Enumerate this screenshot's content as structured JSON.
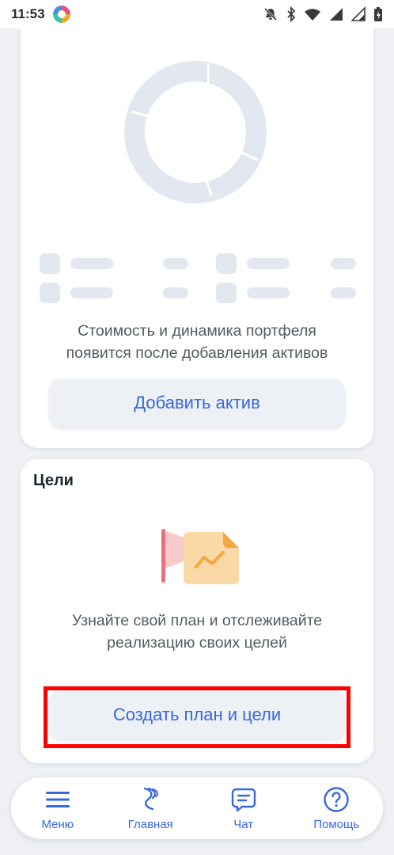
{
  "status_bar": {
    "time": "11:53",
    "icons": [
      "app-logo-icon",
      "mute-icon",
      "bluetooth-icon",
      "wifi-icon",
      "signal-icon",
      "signal-icon-2",
      "battery-icon"
    ]
  },
  "portfolio_card": {
    "empty_text": "Стоимость и динамика портфеля появится после добавления активов",
    "add_asset_label": "Добавить актив",
    "placeholder_color": "#e3e7ef"
  },
  "goals_card": {
    "title": "Цели",
    "description": "Узнайте свой план и отслеживайте реализацию своих целей",
    "create_plan_label": "Создать план и цели"
  },
  "bottom_nav": {
    "items": [
      {
        "label": "Меню",
        "icon": "menu-icon"
      },
      {
        "label": "Главная",
        "icon": "home-logo-icon"
      },
      {
        "label": "Чат",
        "icon": "chat-icon"
      },
      {
        "label": "Помощь",
        "icon": "help-icon"
      }
    ]
  },
  "colors": {
    "accent": "#3868df",
    "background": "#eef0f4",
    "highlight": "#ff0000"
  }
}
